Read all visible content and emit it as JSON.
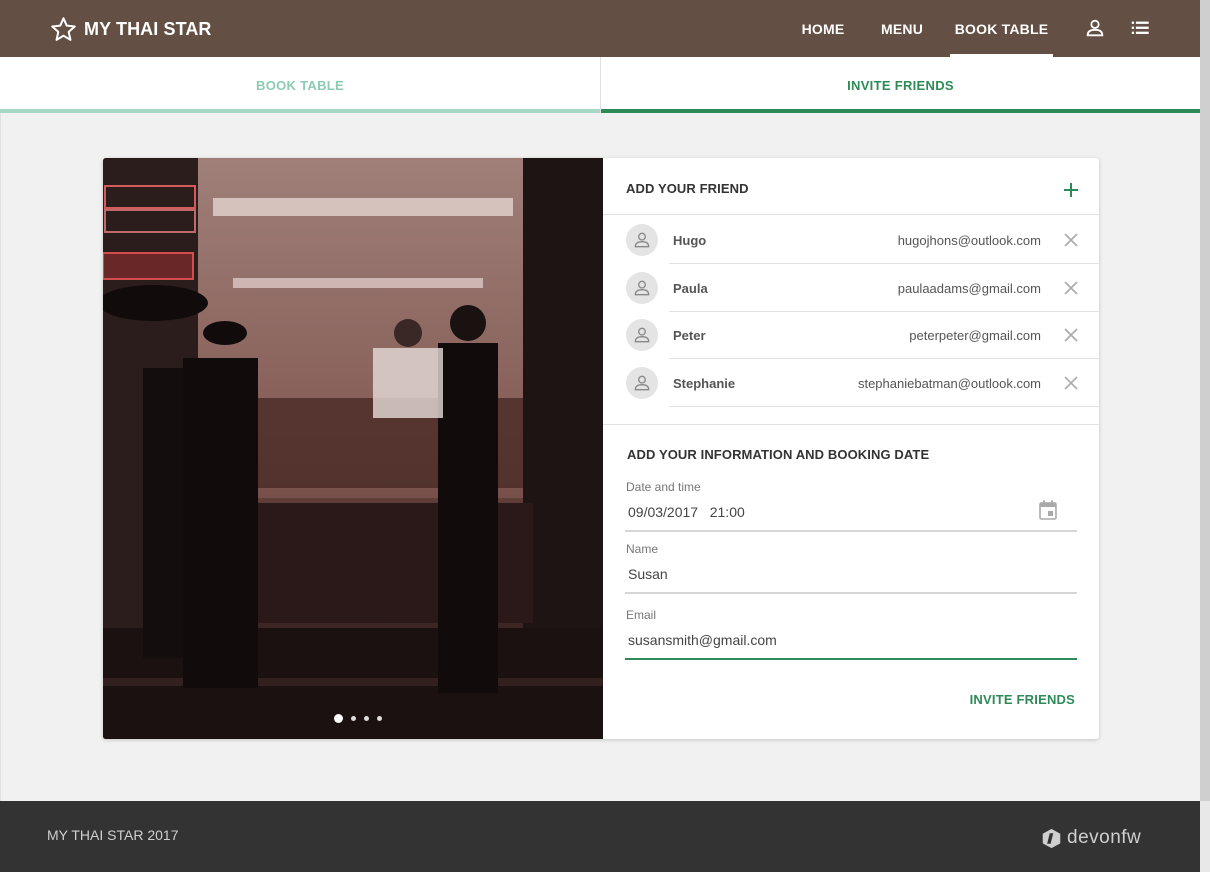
{
  "header": {
    "brand": "MY THAI STAR",
    "nav": [
      "HOME",
      "MENU",
      "BOOK TABLE"
    ],
    "active_nav": "BOOK TABLE"
  },
  "tabs": [
    {
      "label": "BOOK TABLE",
      "active": false
    },
    {
      "label": "INVITE FRIENDS",
      "active": true
    }
  ],
  "carousel": {
    "slides": 4,
    "active_index": 0
  },
  "friends_section": {
    "title": "ADD YOUR FRIEND",
    "friends": [
      {
        "name": "Hugo",
        "email": "hugojhons@outlook.com"
      },
      {
        "name": "Paula",
        "email": "paulaadams@gmail.com"
      },
      {
        "name": "Peter",
        "email": "peterpeter@gmail.com"
      },
      {
        "name": "Stephanie",
        "email": "stephaniebatman@outlook.com"
      }
    ]
  },
  "info_section": {
    "title": "ADD YOUR INFORMATION AND BOOKING DATE",
    "date": {
      "label": "Date and time",
      "value": "09/03/2017   21:00"
    },
    "name": {
      "label": "Name",
      "value": "Susan"
    },
    "email": {
      "label": "Email",
      "value": "susansmith@gmail.com"
    },
    "submit_label": "INVITE FRIENDS"
  },
  "footer": {
    "copyright": "MY THAI STAR 2017",
    "logo_text": "devonfw"
  },
  "icons": {
    "brand": "star-outline-icon",
    "user": "person-icon",
    "menu": "list-icon",
    "add": "plus-icon",
    "remove": "close-icon",
    "calendar": "calendar-icon",
    "avatar": "person-avatar-icon"
  },
  "colors": {
    "header_bg": "#634f43",
    "accent": "#2e8b57",
    "accent_light": "#a6d8c4",
    "footer_bg": "#333333",
    "page_bg": "#f1f1f1"
  }
}
